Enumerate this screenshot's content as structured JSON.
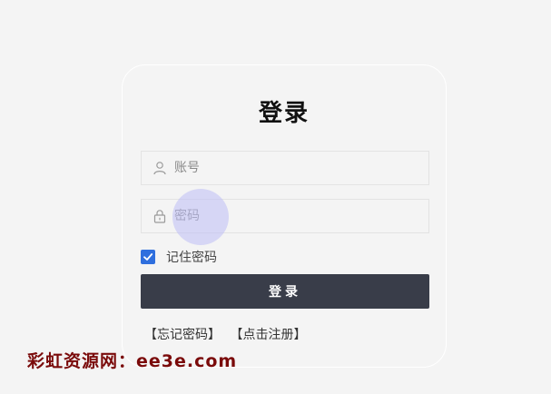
{
  "login": {
    "title": "登录",
    "username_placeholder": "账号",
    "password_placeholder": "密码",
    "remember_label": "记住密码",
    "remember_checked": true,
    "submit_label": "登录",
    "forgot_link": "【忘记密码】",
    "register_link": "【点击注册】"
  },
  "icons": {
    "username": "user-icon",
    "password": "lock-icon",
    "checkbox": "checkmark-icon"
  },
  "watermark": {
    "text": "彩虹资源网：ee3e.com"
  },
  "colors": {
    "background": "#f4f4f4",
    "button": "#393d49",
    "checkbox": "#2f6fde",
    "watermark": "#7a0a0a"
  }
}
